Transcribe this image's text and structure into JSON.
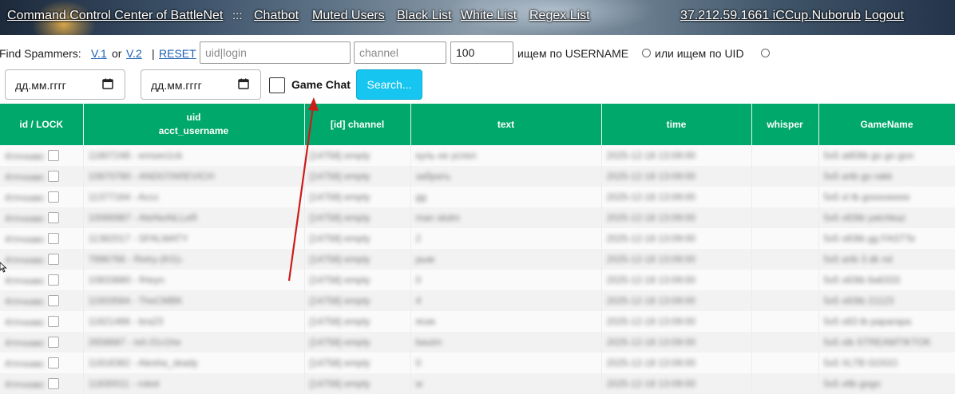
{
  "nav": {
    "title": "Command Control Center of BattleNet",
    "separator": ":::",
    "links": [
      "Chatbot",
      "Muted Users",
      "Black List",
      "White List",
      "Regex List"
    ],
    "user": "37.212.59.1661 iCCup.Nuborub",
    "logout": "Logout"
  },
  "filters": {
    "find_label": "Find Spammers:",
    "v1": "V.1",
    "or_text": "or",
    "v2": " V.2",
    "pipe": "|",
    "reset": "RESET",
    "uid_placeholder": "uid|login",
    "channel_placeholder": "channel",
    "limit_value": "100",
    "by_username": "ищем по USERNAME",
    "or_by_uid": "или ищем по UID",
    "date_placeholder": "дд.мм.гггг",
    "game_chat": "Game Chat",
    "search": "Search..."
  },
  "table": {
    "headers": [
      "id / LOCK",
      "uid\nacct_username",
      "[id] channel",
      "text",
      "time",
      "whisper",
      "GameName"
    ],
    "rows": [
      [
        "4тпчхавс",
        "11807248 - emsen1ck",
        "[14758] empty",
        "куль не успел",
        "2025-12-18 13:09:00",
        "",
        "5x5 at83tb go go goo"
      ],
      [
        "4тпчхавс",
        "10870780 - ANDOTAREVICH",
        "[14758] empty",
        "забрать",
        "2025-12-18 13:09:00",
        "",
        "5x5 artb go rakk"
      ],
      [
        "4тпчхавс",
        "11377164 - Accc",
        "[14758] empty",
        "gg",
        "2025-12-18 13:09:00",
        "",
        "5x5 xl tb gooooeeee"
      ],
      [
        "4тпчхавс",
        "10066987 - AteNeAtLLeR",
        "[14758] empty",
        "man skdm",
        "2025-12-18 13:09:00",
        "",
        "5x5 x83tb yatchkaz"
      ],
      [
        "4тпчхавс",
        "11382017 - SFALMATY",
        "[14758] empty",
        "2",
        "2025-12-18 13:09:00",
        "",
        "5x5 x83tb gg FASTTe"
      ],
      [
        "4тпчхавс",
        "7996766 - Retry-(KG)-",
        "[14758] empty",
        "рым",
        "2025-12-18 13:09:00",
        "",
        "5x5 artb 3 dk nd"
      ],
      [
        "4тпчхавс",
        "10833880 - fHeyn",
        "[14758] empty",
        "0",
        "2025-12-18 13:09:00",
        "",
        "5x5 x83tb 6a6333"
      ],
      [
        "4тпчхавс",
        "11933584 - TheCMBK",
        "[14758] empty",
        "4",
        "2025-12-18 13:09:00",
        "",
        "5x5 x83tb 21123"
      ],
      [
        "4тпчхавс",
        "11821486 - bra23",
        "[14758] empty",
        "ясик",
        "2025-12-18 13:09:00",
        "",
        "5x5 x83 tb paparapa"
      ],
      [
        "4тпчхавс",
        "2658687 - tsh.01v1he",
        "[14758] empty",
        "bauim",
        "2025-12-18 13:09:00",
        "",
        "5x5 xlb STREAMTIKTOK"
      ],
      [
        "4тпчхавс",
        "11818382 - Alesha_skady",
        "[14758] empty",
        "0",
        "2025-12-18 13:09:00",
        "",
        "5x5 XLTB GOGO"
      ],
      [
        "4тпчхавс",
        "11830011 - roket",
        "[14758] empty",
        "w",
        "2025-12-18 13:09:00",
        "",
        "5x5 xltb gogo"
      ]
    ]
  },
  "colors": {
    "header_green": "#00a86b",
    "search_button": "#17c6f0",
    "link_blue": "#1a5fb4",
    "annotation_arrow": "#cc1b1b"
  }
}
